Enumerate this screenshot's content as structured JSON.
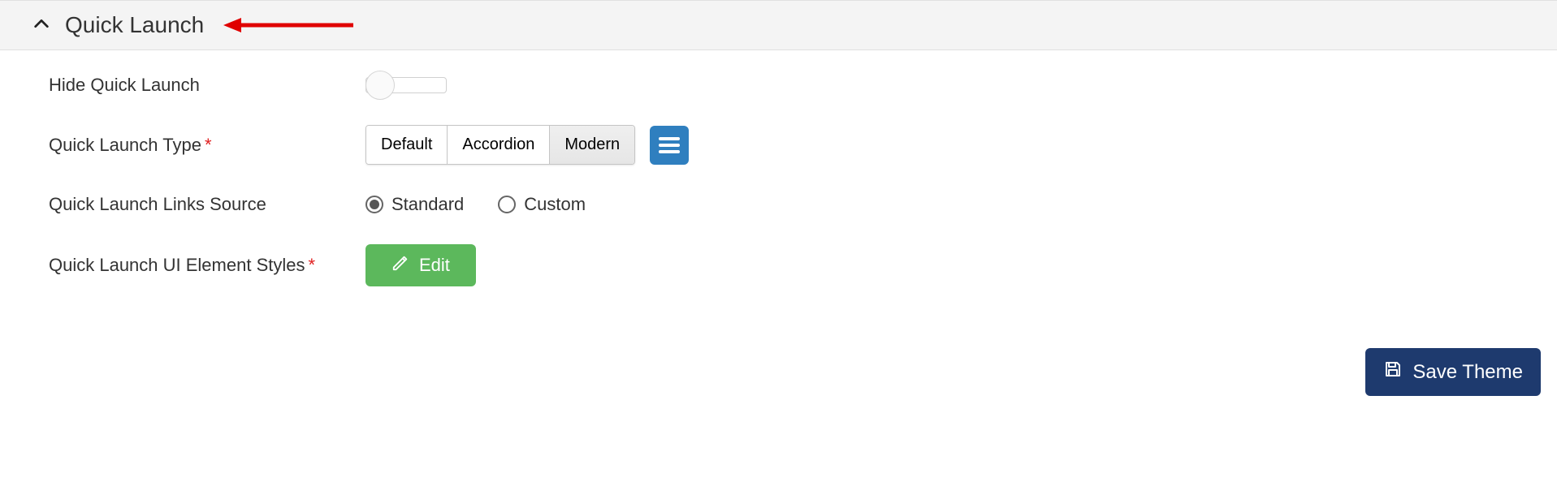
{
  "section": {
    "title": "Quick Launch"
  },
  "fields": {
    "hide_label": "Hide Quick Launch",
    "type_label": "Quick Launch Type",
    "links_label": "Quick Launch Links Source",
    "styles_label": "Quick Launch UI Element Styles"
  },
  "type_options": {
    "default": "Default",
    "accordion": "Accordion",
    "modern": "Modern",
    "selected": "modern"
  },
  "links_options": {
    "standard": "Standard",
    "custom": "Custom",
    "selected": "standard"
  },
  "buttons": {
    "edit": "Edit",
    "save": "Save Theme"
  },
  "toggle": {
    "hide_quick_launch": false
  }
}
